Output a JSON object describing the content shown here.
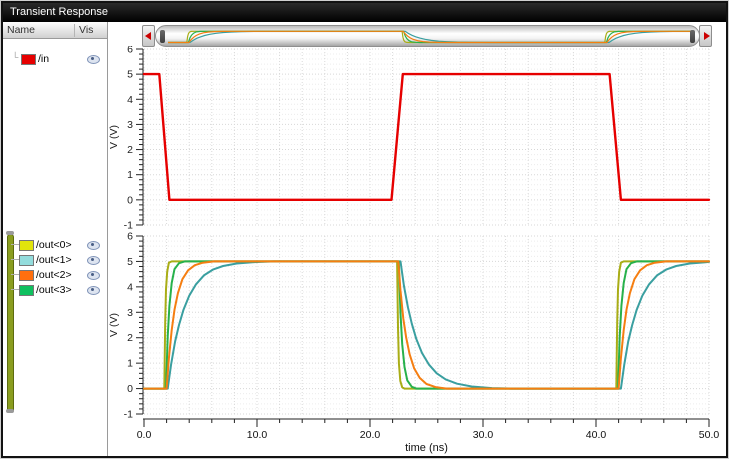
{
  "window": {
    "title": "Transient Response"
  },
  "sidebar": {
    "header": {
      "name_col": "Name",
      "vis_col": "Vis"
    },
    "signals": [
      {
        "label": "/in",
        "swatch": "#e60000"
      },
      {
        "label": "/out<0>",
        "swatch": "#e1e40c"
      },
      {
        "label": "/out<1>",
        "swatch": "#93dcdc"
      },
      {
        "label": "/out<2>",
        "swatch": "#ff6f0e"
      },
      {
        "label": "/out<3>",
        "swatch": "#0fc05f"
      }
    ],
    "group_bar_color": "#8a9d1f"
  },
  "overview": {
    "arrow_color": "#cc0000"
  },
  "chart_data": [
    {
      "type": "line",
      "title": "",
      "xlabel": "time (ns)",
      "ylabel": "V (V)",
      "xlim": [
        0,
        50
      ],
      "ylim": [
        -1,
        6
      ],
      "x_tick_labels": [
        "0.0",
        "10.0",
        "20.0",
        "30.0",
        "40.0",
        "50.0"
      ],
      "y_tick_labels": [
        "-1",
        "0",
        "1",
        "2",
        "3",
        "4",
        "5",
        "6"
      ],
      "x_major_step": 10,
      "x_minor_step": 2,
      "y_major_step": 1,
      "y_minor_step": 0.2,
      "grid": true,
      "legend_position": "left-panel",
      "show_x_axis": false,
      "series": [
        {
          "name": "/in",
          "color": "#e60000",
          "width": 2.4,
          "points": [
            [
              0,
              5
            ],
            [
              1.35,
              5
            ],
            [
              2.25,
              0
            ],
            [
              21.9,
              0
            ],
            [
              22.9,
              5
            ],
            [
              41.2,
              5
            ],
            [
              42.2,
              0
            ],
            [
              50,
              0
            ]
          ]
        }
      ]
    },
    {
      "type": "line",
      "title": "",
      "xlabel": "time (ns)",
      "ylabel": "V (V)",
      "xlim": [
        0,
        50
      ],
      "ylim": [
        -1,
        6
      ],
      "x_tick_labels": [
        "0.0",
        "10.0",
        "20.0",
        "30.0",
        "40.0",
        "50.0"
      ],
      "y_tick_labels": [
        "-1",
        "0",
        "1",
        "2",
        "3",
        "4",
        "5",
        "6"
      ],
      "x_major_step": 10,
      "x_minor_step": 2,
      "y_major_step": 1,
      "y_minor_step": 0.2,
      "grid": true,
      "legend_position": "left-panel",
      "show_x_axis": true,
      "series": [
        {
          "name": "/out<1>",
          "color": "#3a9fa0",
          "width": 2,
          "points": [
            [
              0,
              0
            ],
            [
              2.1,
              0
            ],
            [
              2.4,
              0.95
            ],
            [
              2.75,
              1.85
            ],
            [
              3.1,
              2.5
            ],
            [
              3.5,
              3.1
            ],
            [
              4.0,
              3.65
            ],
            [
              4.6,
              4.1
            ],
            [
              5.3,
              4.45
            ],
            [
              6.1,
              4.68
            ],
            [
              7.0,
              4.82
            ],
            [
              8.2,
              4.92
            ],
            [
              9.6,
              4.97
            ],
            [
              11.5,
              5
            ],
            [
              22.7,
              5
            ],
            [
              23.0,
              4.05
            ],
            [
              23.35,
              3.2
            ],
            [
              23.7,
              2.55
            ],
            [
              24.1,
              1.95
            ],
            [
              24.6,
              1.4
            ],
            [
              25.2,
              0.95
            ],
            [
              25.9,
              0.6
            ],
            [
              26.7,
              0.36
            ],
            [
              27.7,
              0.19
            ],
            [
              29.0,
              0.08
            ],
            [
              30.8,
              0.02
            ],
            [
              32.5,
              0
            ],
            [
              42.2,
              0
            ],
            [
              42.5,
              0.95
            ],
            [
              42.85,
              1.85
            ],
            [
              43.2,
              2.5
            ],
            [
              43.6,
              3.1
            ],
            [
              44.1,
              3.65
            ],
            [
              44.7,
              4.1
            ],
            [
              45.4,
              4.45
            ],
            [
              46.2,
              4.68
            ],
            [
              47.1,
              4.82
            ],
            [
              48.3,
              4.92
            ],
            [
              49.7,
              4.97
            ],
            [
              50,
              4.98
            ]
          ]
        },
        {
          "name": "/out<0>",
          "color": "#a9ad16",
          "width": 2,
          "points": [
            [
              0,
              0
            ],
            [
              1.8,
              0
            ],
            [
              1.88,
              2.6
            ],
            [
              1.95,
              3.9
            ],
            [
              2.05,
              4.6
            ],
            [
              2.2,
              4.95
            ],
            [
              2.45,
              5
            ],
            [
              22.4,
              5
            ],
            [
              22.48,
              2.4
            ],
            [
              22.56,
              1.0
            ],
            [
              22.68,
              0.3
            ],
            [
              22.85,
              0.05
            ],
            [
              23.05,
              0
            ],
            [
              41.8,
              0
            ],
            [
              41.88,
              2.6
            ],
            [
              41.95,
              3.9
            ],
            [
              42.05,
              4.6
            ],
            [
              42.2,
              4.95
            ],
            [
              42.45,
              5
            ],
            [
              50,
              5
            ]
          ]
        },
        {
          "name": "/out<3>",
          "color": "#27b14b",
          "width": 2,
          "points": [
            [
              0,
              0
            ],
            [
              1.95,
              0
            ],
            [
              2.1,
              2.05
            ],
            [
              2.25,
              3.25
            ],
            [
              2.45,
              4.15
            ],
            [
              2.7,
              4.7
            ],
            [
              3.1,
              4.93
            ],
            [
              3.6,
              5
            ],
            [
              22.55,
              5
            ],
            [
              22.7,
              2.95
            ],
            [
              22.85,
              1.75
            ],
            [
              23.05,
              0.85
            ],
            [
              23.3,
              0.32
            ],
            [
              23.7,
              0.07
            ],
            [
              24.1,
              0
            ],
            [
              41.95,
              0
            ],
            [
              42.1,
              2.05
            ],
            [
              42.25,
              3.25
            ],
            [
              42.45,
              4.15
            ],
            [
              42.7,
              4.7
            ],
            [
              43.1,
              4.93
            ],
            [
              43.6,
              5
            ],
            [
              50,
              5
            ]
          ]
        },
        {
          "name": "/out<2>",
          "color": "#f57e11",
          "width": 2,
          "points": [
            [
              0,
              0
            ],
            [
              2.0,
              0
            ],
            [
              2.2,
              1.2
            ],
            [
              2.45,
              2.3
            ],
            [
              2.7,
              3.1
            ],
            [
              3.0,
              3.75
            ],
            [
              3.4,
              4.3
            ],
            [
              3.9,
              4.65
            ],
            [
              4.5,
              4.85
            ],
            [
              5.2,
              4.95
            ],
            [
              6.2,
              5
            ],
            [
              22.5,
              5
            ],
            [
              22.7,
              3.85
            ],
            [
              22.95,
              2.75
            ],
            [
              23.2,
              2.0
            ],
            [
              23.5,
              1.35
            ],
            [
              23.9,
              0.8
            ],
            [
              24.4,
              0.42
            ],
            [
              25.0,
              0.18
            ],
            [
              25.8,
              0.06
            ],
            [
              26.8,
              0
            ],
            [
              42.0,
              0
            ],
            [
              42.2,
              1.2
            ],
            [
              42.45,
              2.3
            ],
            [
              42.7,
              3.1
            ],
            [
              43.0,
              3.75
            ],
            [
              43.4,
              4.3
            ],
            [
              43.9,
              4.65
            ],
            [
              44.5,
              4.85
            ],
            [
              45.2,
              4.95
            ],
            [
              46.2,
              5
            ],
            [
              50,
              5
            ]
          ]
        }
      ]
    }
  ]
}
